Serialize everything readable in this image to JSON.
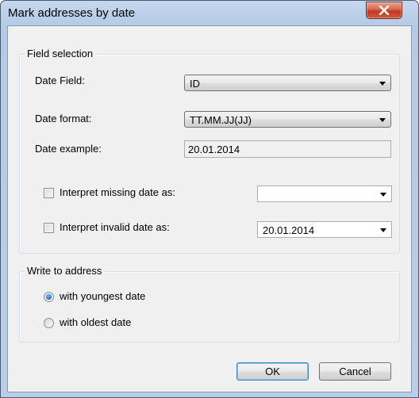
{
  "window": {
    "title": "Mark addresses by date"
  },
  "field_selection": {
    "legend": "Field selection",
    "date_field_label": "Date Field:",
    "date_field_value": "ID",
    "date_format_label": "Date format:",
    "date_format_value": "TT.MM.JJ(JJ)",
    "date_example_label": "Date example:",
    "date_example_value": "20.01.2014",
    "missing_label": "Interpret missing date as:",
    "missing_checked": false,
    "missing_value": "",
    "invalid_label": "Interpret invalid date as:",
    "invalid_checked": false,
    "invalid_value": "20.01.2014"
  },
  "write_to_address": {
    "legend": "Write to address",
    "options": [
      {
        "label": "with youngest date",
        "selected": true
      },
      {
        "label": "with oldest date",
        "selected": false
      }
    ]
  },
  "buttons": {
    "ok": "OK",
    "cancel": "Cancel"
  },
  "icons": {
    "close": "close-icon",
    "dropdown": "chevron-down-icon"
  },
  "colors": {
    "title_bar": "#b9cfe8",
    "close_button": "#c4381f",
    "client_bg": "#f0f0f0",
    "radio_selected": "#2a7ad4"
  }
}
